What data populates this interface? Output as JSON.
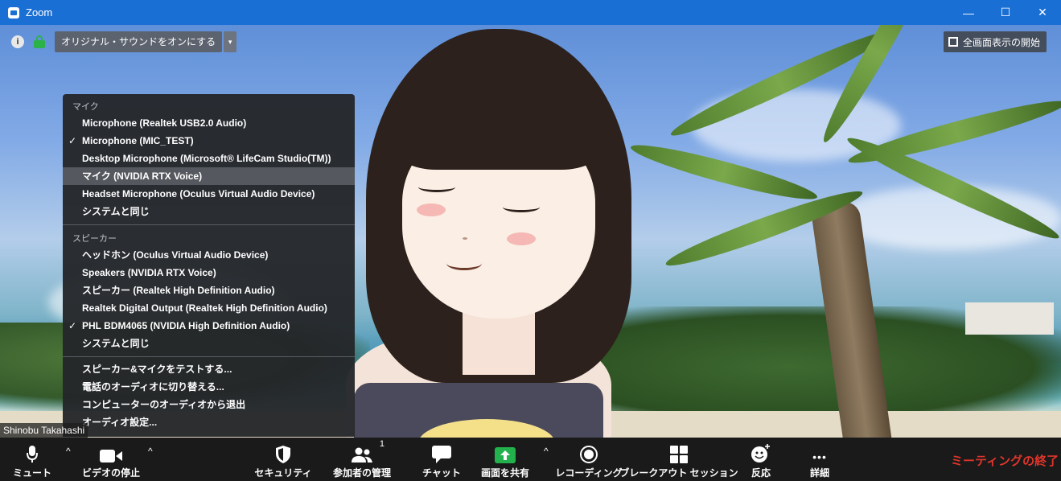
{
  "window": {
    "title": "Zoom",
    "controls": {
      "minimize": "—",
      "maximize": "☐",
      "close": "✕"
    }
  },
  "topbar": {
    "info_glyph": "i",
    "original_sound_label": "オリジナル・サウンドをオンにする",
    "dropdown_glyph": "▾",
    "fullscreen_label": "全画面表示の開始"
  },
  "audio_menu": {
    "mic_header": "マイク",
    "mic_items": [
      {
        "label": "Microphone (Realtek USB2.0 Audio)",
        "checked": false,
        "highlighted": false
      },
      {
        "label": "Microphone (MIC_TEST)",
        "checked": true,
        "highlighted": false
      },
      {
        "label": "Desktop Microphone (Microsoft® LifeCam Studio(TM))",
        "checked": false,
        "highlighted": false
      },
      {
        "label": "マイク (NVIDIA RTX Voice)",
        "checked": false,
        "highlighted": true
      },
      {
        "label": "Headset Microphone (Oculus Virtual Audio Device)",
        "checked": false,
        "highlighted": false
      },
      {
        "label": "システムと同じ",
        "checked": false,
        "highlighted": false
      }
    ],
    "speaker_header": "スピーカー",
    "speaker_items": [
      {
        "label": "ヘッドホン (Oculus Virtual Audio Device)",
        "checked": false
      },
      {
        "label": "Speakers (NVIDIA RTX Voice)",
        "checked": false
      },
      {
        "label": "スピーカー (Realtek High Definition Audio)",
        "checked": false
      },
      {
        "label": "Realtek Digital Output (Realtek High Definition Audio)",
        "checked": false
      },
      {
        "label": "PHL BDM4065 (NVIDIA High Definition Audio)",
        "checked": true
      },
      {
        "label": "システムと同じ",
        "checked": false
      }
    ],
    "actions": [
      "スピーカー&マイクをテストする...",
      "電話のオーディオに切り替える...",
      "コンピューターのオーディオから退出",
      "オーディオ設定..."
    ],
    "check_glyph": "✓"
  },
  "participant_name": "Shinobu Takahashi",
  "toolbar": {
    "mute": "ミュート",
    "stop_video": "ビデオの停止",
    "security": "セキュリティ",
    "participants": "参加者の管理",
    "participants_count": "1",
    "chat": "チャット",
    "share_screen": "画面を共有",
    "recording": "レコーディング",
    "breakout": "ブレークアウト セッション",
    "reactions": "反応",
    "more": "詳細",
    "more_glyph": "•••",
    "caret_glyph": "^",
    "end_meeting": "ミーティングの終了"
  },
  "colors": {
    "titlebar": "#1a6fd4",
    "menu_bg": "#24262a",
    "highlight": "#55585e",
    "share_green": "#23b14d",
    "end_red": "#e0352b",
    "lock_green": "#2bb34a"
  },
  "icons": [
    "zoom-logo-icon",
    "info-icon",
    "lock-icon",
    "fullscreen-icon",
    "microphone-icon",
    "video-camera-icon",
    "shield-icon",
    "participants-icon",
    "chat-icon",
    "share-screen-icon",
    "record-icon",
    "breakout-icon",
    "emoji-icon",
    "more-icon",
    "checkmark-icon"
  ]
}
